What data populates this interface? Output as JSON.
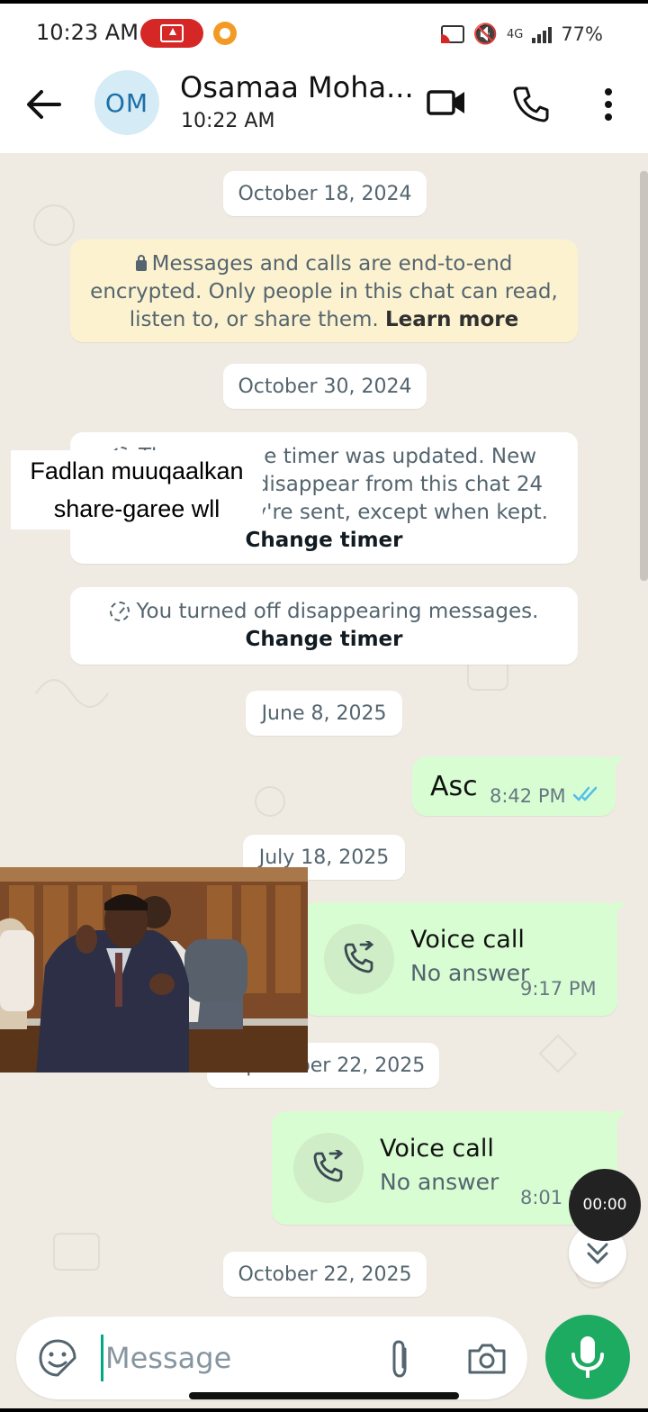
{
  "status_bar": {
    "time": "10:23 AM",
    "network": "4G",
    "battery": "77%",
    "icons": [
      "screen-record-icon",
      "recorder-app-icon",
      "cast-icon",
      "mute-vibrate-icon",
      "signal-icon",
      "battery-text"
    ]
  },
  "header": {
    "avatar_initials": "OM",
    "contact_name": "Osamaa Moha...",
    "last_seen": "10:22 AM"
  },
  "chat": {
    "dates": {
      "d1": "October 18, 2024",
      "d2": "October 30, 2024",
      "d3": "June 8, 2025",
      "d4": "July 18, 2025",
      "d5": "September 22, 2025",
      "d6": "October 22, 2025"
    },
    "encryption_notice": {
      "line1": "Messages and calls are end-to-end",
      "line2": "encrypted. Only people in this chat can read,",
      "line3": "listen to, or share them.",
      "link": "Learn more"
    },
    "timer_notice": {
      "line1": "The message timer was updated. New",
      "line2": "messages will disappear from this chat 24",
      "line3": "hours after they're sent, except when kept.",
      "link": "Change timer"
    },
    "off_notice": {
      "text": "You turned off disappearing messages.",
      "link": "Change timer"
    },
    "messages": {
      "asc": {
        "text": "Asc",
        "time": "8:42 PM"
      },
      "call1": {
        "title": "Voice call",
        "status": "No answer",
        "time": "9:17 PM"
      },
      "call2": {
        "title": "Voice call",
        "status": "No answer",
        "time": "8:01 PM"
      }
    }
  },
  "overlay": {
    "caption_line1": "Fadlan muuqaalkan",
    "caption_line2": "share-garee wll",
    "recording_time": "00:00"
  },
  "composer": {
    "placeholder": "Message"
  },
  "colors": {
    "chat_bg": "#efeae2",
    "outgoing_bubble": "#d9fdd3",
    "encryption_bg": "#fdf2cf",
    "mic_button": "#1daa61",
    "read_ticks": "#53bdeb",
    "record_pill": "#d62727"
  }
}
